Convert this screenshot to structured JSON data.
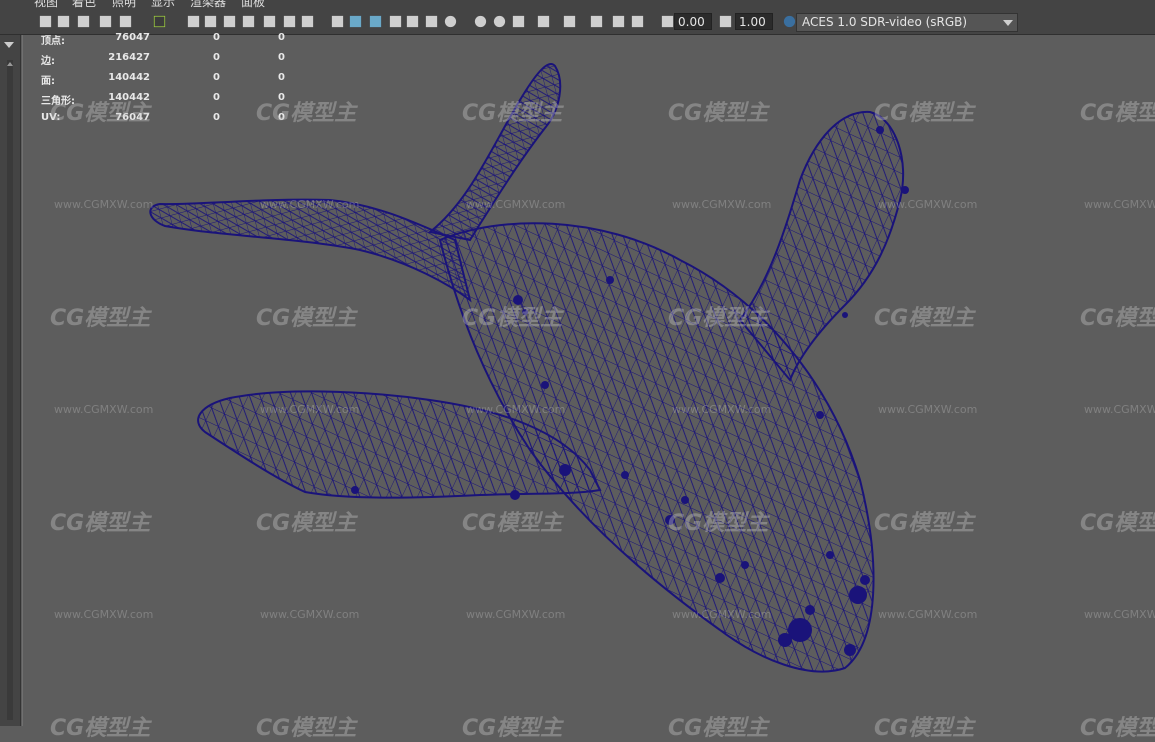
{
  "menu": [
    "视图",
    "着色",
    "照明",
    "显示",
    "渲染器",
    "面板"
  ],
  "toolbar": {
    "exposure_value": "0.00",
    "gamma_value": "1.00",
    "color_space": "ACES 1.0 SDR-video (sRGB)",
    "icons": [
      "camera-icon",
      "camera-lock-icon",
      "camera-attributes-icon",
      "bookmark-icon",
      "pan-zoom-icon",
      "grease-pencil-icon",
      "grid-icon",
      "film-gate-icon",
      "resolution-gate-icon",
      "gate-mask-icon",
      "field-chart-icon",
      "safe-action-icon",
      "safe-title-icon",
      "wireframe-icon",
      "smooth-shade-icon",
      "wireframe-on-shaded-icon",
      "textured-icon",
      "xray-icon",
      "use-all-lights-icon",
      "shadows-icon",
      "ambient-occlusion-icon",
      "motion-blur-icon",
      "anti-aliasing-icon",
      "depth-of-field-icon",
      "isolate-select-icon",
      "xray-joints-icon",
      "xray-active-icon",
      "backface-culling-icon",
      "exposure-icon",
      "gamma-icon",
      "color-management-icon"
    ]
  },
  "hud": {
    "rows": [
      {
        "label": "顶点:",
        "v1": "76047",
        "v2": "0",
        "v3": "0"
      },
      {
        "label": "边:",
        "v1": "216427",
        "v2": "0",
        "v3": "0"
      },
      {
        "label": "面:",
        "v1": "140442",
        "v2": "0",
        "v3": "0"
      },
      {
        "label": "三角形:",
        "v1": "140442",
        "v2": "0",
        "v3": "0"
      },
      {
        "label": "UV:",
        "v1": "76047",
        "v2": "0",
        "v3": "0"
      }
    ]
  },
  "watermark": {
    "logo": "CG模型主",
    "url": "www.CGMXW.com"
  },
  "colors": {
    "wire": "#1a137a",
    "viewport_bg": "#5d5d5d",
    "ui_bg": "#444444"
  }
}
